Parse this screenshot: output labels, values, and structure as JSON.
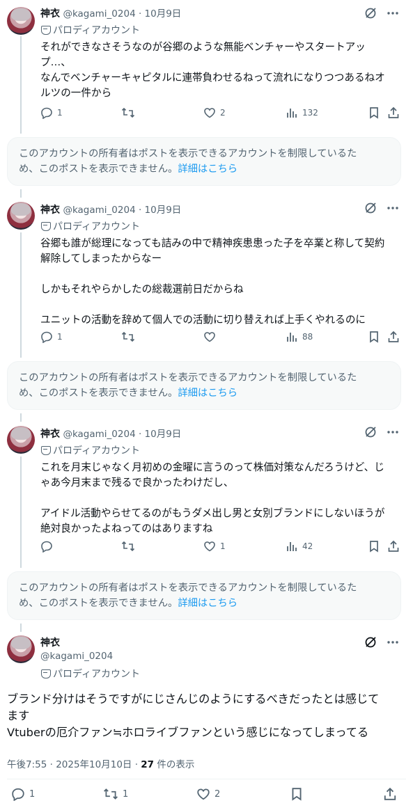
{
  "tweets": [
    {
      "name": "神衣",
      "meta": "@kagami_0204 · 10月9日",
      "parody": "パロディアカウント",
      "lines": [
        "それができなさそうなのが谷郷のような無能ベンチャーやスタートアッ",
        "プ…、",
        "なんでベンチャーキャピタルに連帯負わせるねって流れになりつつあるねオ",
        "ルツの一件から"
      ],
      "replies": "1",
      "retweets": "",
      "likes": "2",
      "views": "132"
    },
    {
      "name": "神衣",
      "meta": "@kagami_0204 · 10月9日",
      "parody": "パロディアカウント",
      "lines": [
        "谷郷も誰が総理になっても詰みの中で精神疾患患った子を卒業と称して契約",
        "解除してしまったからなー",
        "",
        "しかもそれやらかしたの総裁選前日だからね",
        "",
        "ユニットの活動を辞めて個人での活動に切り替えれば上手くやれるのに"
      ],
      "replies": "1",
      "retweets": "",
      "likes": "",
      "views": "88"
    },
    {
      "name": "神衣",
      "meta": "@kagami_0204 · 10月9日",
      "parody": "パロディアカウント",
      "lines": [
        "これを月末じゃなく月初めの金曜に言うのって株価対策なんだろうけど、じ",
        "ゃあ今月末まで残るで良かったわけだし、",
        "",
        "アイドル活動やらせてるのがもうダメ出し男と女別ブランドにしないほうが",
        "絶対良かったよねってのはありますね"
      ],
      "replies": "",
      "retweets": "",
      "likes": "1",
      "views": "42"
    }
  ],
  "restricted": {
    "text_line1": "このアカウントの所有者はポストを表示できるアカウントを制限しているた",
    "text_line2": "め、このポストを表示できません。",
    "link": "詳細はこちら"
  },
  "main": {
    "name": "神衣",
    "handle": "@kagami_0204",
    "parody": "パロディアカウント",
    "lines": [
      "ブランド分けはそうですがにじさんじのようにするべきだったとは感じて",
      "ます",
      "Vtuberの厄介ファン≒ホロライブファンという感じになってしまってる"
    ],
    "time": "午後7:55 · 2025年10月10日 · ",
    "views_count": "27",
    "views_label": " 件の表示",
    "replies": "1",
    "retweets": "1",
    "likes": "2"
  },
  "colors": {
    "accent": "#1d9bf0",
    "muted": "#536471",
    "text": "#0f1419"
  }
}
